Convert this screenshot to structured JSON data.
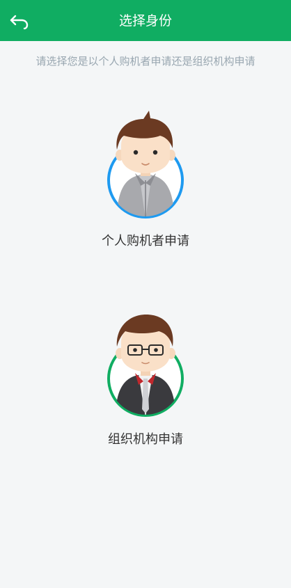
{
  "header": {
    "title": "选择身份",
    "back_icon": "back-arrow-icon",
    "background_color": "#10ad62"
  },
  "subtitle": "请选择您是以个人购机者申请还是组织机构申请",
  "options": [
    {
      "label": "个人购机者申请",
      "icon": "personal-avatar-icon",
      "ring_color": "#1e9af0"
    },
    {
      "label": "组织机构申请",
      "icon": "organization-avatar-icon",
      "ring_color": "#10ad62"
    }
  ]
}
